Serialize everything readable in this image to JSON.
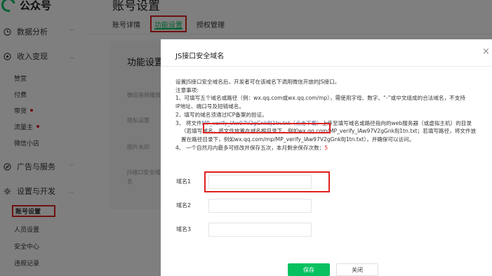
{
  "app": {
    "name": "公众号"
  },
  "sidebar": {
    "sections": [
      {
        "label": "数据分析",
        "icon": "clock-icon"
      },
      {
        "label": "收入变现",
        "icon": "target-icon"
      },
      {
        "label": "广告与服务",
        "icon": "compass-icon"
      },
      {
        "label": "设置与开发",
        "icon": "gear-icon"
      }
    ],
    "income_items": [
      "赞赏",
      "付费",
      "带货",
      "流量主",
      "微信小店"
    ],
    "settings_items": [
      "账号设置",
      "人员设置",
      "安全中心",
      "违规记录"
    ]
  },
  "page": {
    "title": "账号设置",
    "tabs": [
      "账号详情",
      "功能设置",
      "授权管理"
    ],
    "card_title": "功能设置",
    "card_rows": [
      "微信音频播放",
      "隐私设置",
      "图片水印",
      "JS接口安全域",
      "名"
    ]
  },
  "dialog": {
    "title": "JS接口安全域名",
    "close_glyph": "×",
    "intro": "设置JS接口安全域名后，开发者可在该域名下调用微信开放的JS接口。",
    "notes_heading": "注意事项:",
    "note1a": "1、可填写五个域名或路径（例：wx.qq.com或wx.qq.com/mp），需使用字母、数字、“-”或中文组成的合法域名，不支持",
    "note1b": "IP地址、端口号及短链域名。",
    "note2": "2、填写的域名须通过ICP备案的验证。",
    "note3_prefix": "3、 将文件",
    "note3_link": "MP_verify_IAw97V2gGnk8J1tn.txt（点击下载）",
    "note3_suffix": "上传至填写域名或路径指向的web服务器（或虚拟主机）的目录",
    "note3b": "（若填写域名，将文件放置在域名根目录下，例如wx.qq.com/MP_verify_IAw97V2gGnk8J1tn.txt；若填写路径，将文件放",
    "note3c": "置在路径目录下，例如wx.qq.com/mp/MP_verify_IAw97V2gGnk8J1tn.txt），并确保可以访问。",
    "note4_prefix": "4、 一个自然月内最多可修改并保存五次，本月剩余保存次数：",
    "note4_count": "5",
    "fields": [
      {
        "label": "域名1",
        "value": ""
      },
      {
        "label": "域名2",
        "value": ""
      },
      {
        "label": "域名3",
        "value": ""
      }
    ],
    "save_label": "保存",
    "close_label": "关闭"
  },
  "colors": {
    "accent": "#07c160",
    "highlight": "#e02020",
    "link": "#576b95"
  }
}
